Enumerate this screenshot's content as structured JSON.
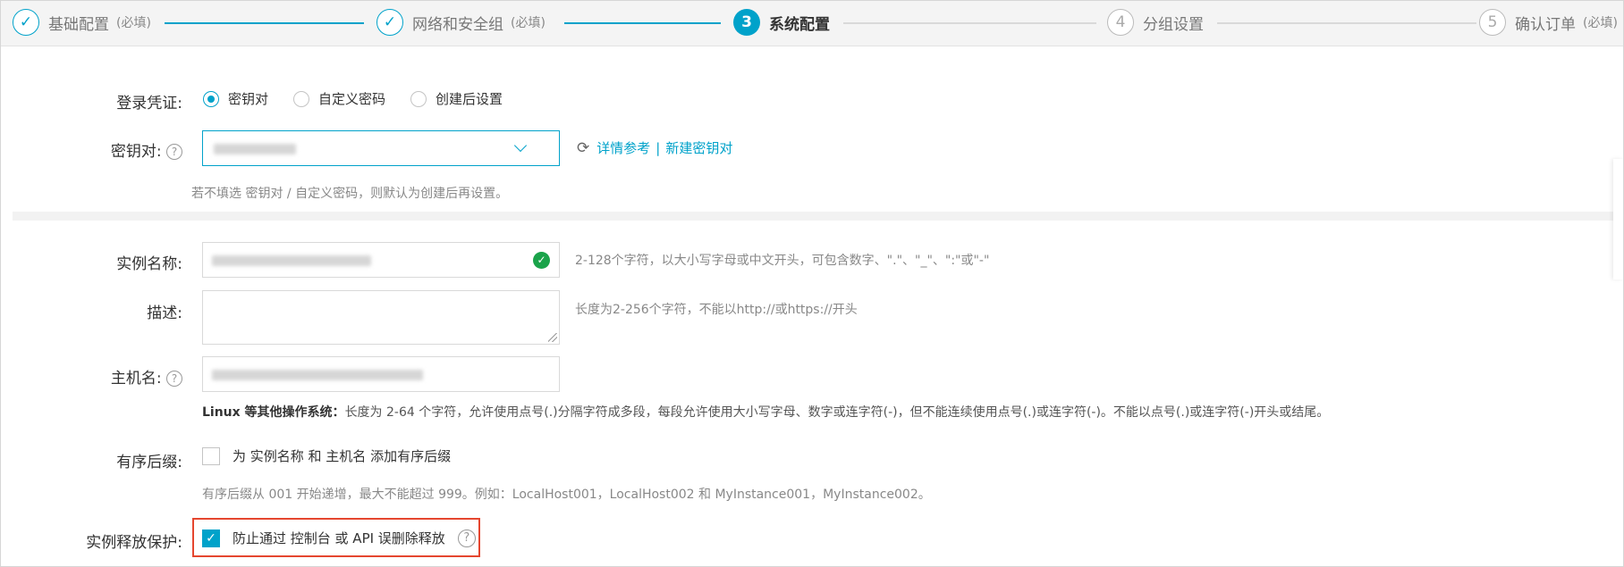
{
  "stepper": {
    "steps": [
      {
        "mark": "✓",
        "title": "基础配置",
        "note": "(必填)",
        "state": "done"
      },
      {
        "mark": "✓",
        "title": "网络和安全组",
        "note": "(必填)",
        "state": "done"
      },
      {
        "mark": "3",
        "title": "系统配置",
        "note": "",
        "state": "active"
      },
      {
        "mark": "4",
        "title": "分组设置",
        "note": "",
        "state": "todo"
      },
      {
        "mark": "5",
        "title": "确认订单",
        "note": "(必填)",
        "state": "todo"
      }
    ]
  },
  "login": {
    "label": "登录凭证:",
    "options": [
      {
        "label": "密钥对",
        "checked": true
      },
      {
        "label": "自定义密码",
        "checked": false
      },
      {
        "label": "创建后设置",
        "checked": false
      }
    ]
  },
  "keypair": {
    "label": "密钥对:",
    "help": "?",
    "refresh_icon": "refresh-icon",
    "link_details": "详情参考",
    "link_sep": "|",
    "link_new": "新建密钥对",
    "hint": "若不填选 密钥对 / 自定义密码，则默认为创建后再设置。"
  },
  "instance_name": {
    "label": "实例名称:",
    "valid_mark": "✓",
    "hint": "2-128个字符，以大小写字母或中文开头，可包含数字、\".\"、\"_\"、\":\"或\"-\""
  },
  "description": {
    "label": "描述:",
    "hint": "长度为2-256个字符，不能以http://或https://开头"
  },
  "hostname": {
    "label": "主机名:",
    "help": "?",
    "note_bold": "Linux 等其他操作系统：",
    "note": "长度为 2-64 个字符，允许使用点号(.)分隔字符成多段，每段允许使用大小写字母、数字或连字符(-)，但不能连续使用点号(.)或连字符(-)。不能以点号(.)或连字符(-)开头或结尾。"
  },
  "suffix": {
    "label": "有序后缀:",
    "checkbox_label": "为 实例名称 和 主机名 添加有序后缀",
    "checked": false,
    "hint": "有序后缀从 001 开始递增，最大不能超过 999。例如：LocalHost001，LocalHost002 和 MyInstance001，MyInstance002。"
  },
  "release_protection": {
    "label": "实例释放保护:",
    "checkbox_label": "防止通过 控制台 或 API 误删除释放",
    "checked": true,
    "check_mark": "✓",
    "help": "?"
  },
  "colors": {
    "accent": "#00a2ca",
    "highlight": "#e5462f",
    "valid": "#1aa34a"
  }
}
